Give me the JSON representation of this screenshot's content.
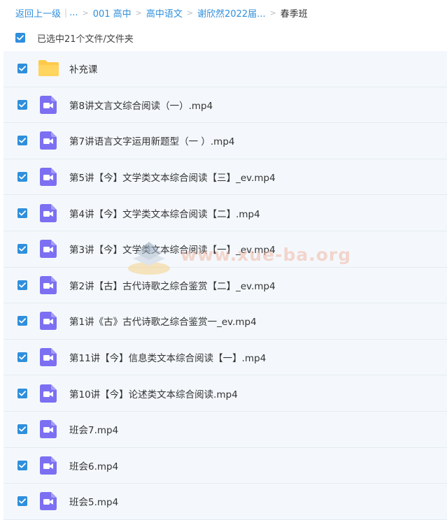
{
  "breadcrumb": {
    "back_label": "返回上一级",
    "ellipsis": "...",
    "crumbs": [
      "001 高中",
      "高中语文",
      "谢欣然2022届..."
    ],
    "current": "春季班"
  },
  "selection": {
    "label": "已选中21个文件/文件夹"
  },
  "files": [
    {
      "name": "补充课",
      "type": "folder"
    },
    {
      "name": "第8讲文言文综合阅读（一）.mp4",
      "type": "video"
    },
    {
      "name": "第7讲语言文字运用新题型（一 ）.mp4",
      "type": "video"
    },
    {
      "name": "第5讲【今】文学类文本综合阅读【三】_ev.mp4",
      "type": "video"
    },
    {
      "name": "第4讲【今】文学类文本综合阅读【二】.mp4",
      "type": "video"
    },
    {
      "name": "第3讲【今】文学类文本综合阅读【一】_ev.mp4",
      "type": "video"
    },
    {
      "name": "第2讲【古】古代诗歌之综合鉴赏【二】_ev.mp4",
      "type": "video"
    },
    {
      "name": "第1讲《古》古代诗歌之综合鉴赏一_ev.mp4",
      "type": "video"
    },
    {
      "name": "第11讲【今】信息类文本综合阅读【一】.mp4",
      "type": "video"
    },
    {
      "name": "第10讲【今】论述类文本综合阅读.mp4",
      "type": "video"
    },
    {
      "name": "班会7.mp4",
      "type": "video"
    },
    {
      "name": "班会6.mp4",
      "type": "video"
    },
    {
      "name": "班会5.mp4",
      "type": "video"
    }
  ],
  "watermark": {
    "text": "www.xue-ba.org"
  },
  "colors": {
    "accent": "#2f8fdd",
    "video_icon": "#7c6ff2",
    "folder": "#ffc94a",
    "row_bg": "#f4f8fc"
  },
  "icons": {
    "check": "check-icon",
    "folder": "folder-icon",
    "video": "video-file-icon"
  }
}
